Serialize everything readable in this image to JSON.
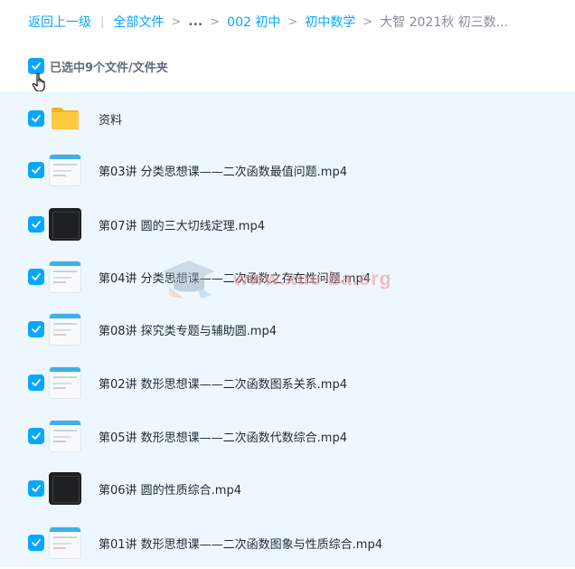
{
  "breadcrumb": {
    "back": "返回上一级",
    "all_files": "全部文件",
    "ellipsis": "...",
    "level1": "002 初中",
    "level2": "初中数学",
    "current": "大智 2021秋 初三数..."
  },
  "selection": {
    "label": "已选中9个文件/文件夹"
  },
  "files": [
    {
      "name": "资料",
      "type": "folder"
    },
    {
      "name": "第03讲 分类思想课——二次函数最值问题.mp4",
      "type": "video"
    },
    {
      "name": "第07讲 圆的三大切线定理.mp4",
      "type": "video"
    },
    {
      "name": "第04讲 分类思想课——二次函数之存在性问题.mp4",
      "type": "video"
    },
    {
      "name": "第08讲 探究类专题与辅助圆.mp4",
      "type": "video"
    },
    {
      "name": "第02讲 数形思想课——二次函数图系关系.mp4",
      "type": "video"
    },
    {
      "name": "第05讲 数形思想课——二次函数代数综合.mp4",
      "type": "video"
    },
    {
      "name": "第06讲 圆的性质综合.mp4",
      "type": "video"
    },
    {
      "name": "第01讲 数形思想课——二次函数图象与性质综合.mp4",
      "type": "video"
    }
  ],
  "watermark": "www.xue-ba.org",
  "colors": {
    "accent": "#06a7ff",
    "list_background": "#eef7fe",
    "folder": "#ffc93e",
    "watermark": "#f08e93"
  },
  "icons": {
    "checkbox": "check-icon",
    "folder": "folder-icon",
    "cursor": "hand-cursor-icon"
  }
}
